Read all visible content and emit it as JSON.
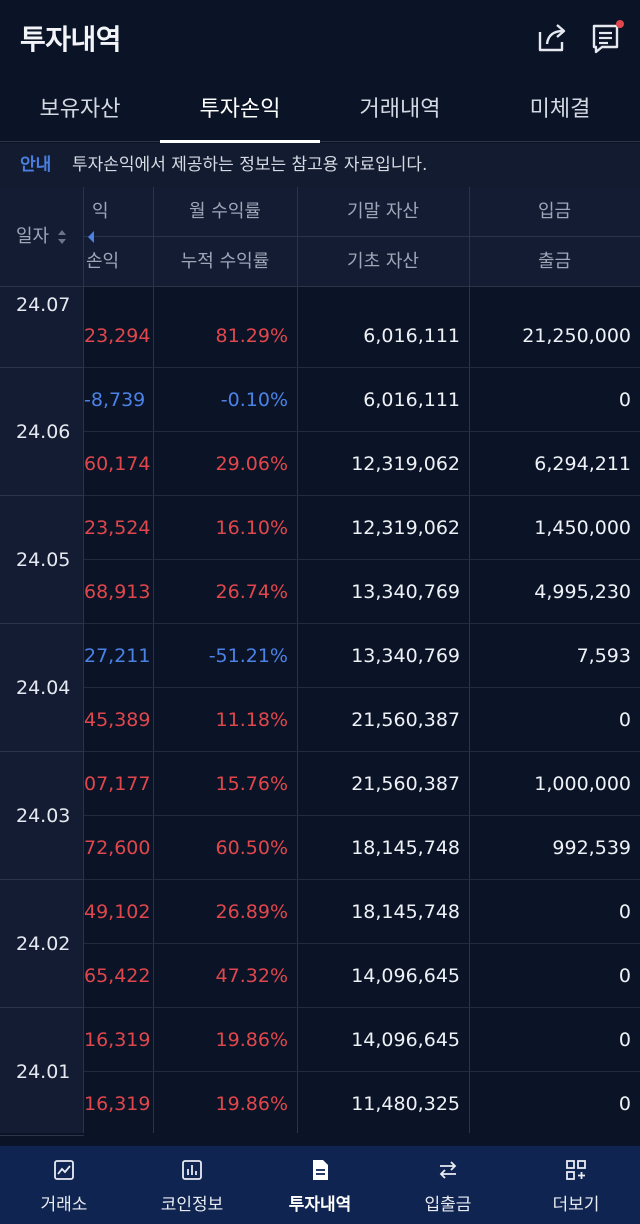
{
  "header": {
    "title": "투자내역",
    "share_icon": "share-icon",
    "chat_icon": "chat-icon",
    "notify_color": "#e0474c"
  },
  "tabs": [
    {
      "label": "보유자산",
      "active": false
    },
    {
      "label": "투자손익",
      "active": true
    },
    {
      "label": "거래내역",
      "active": false
    },
    {
      "label": "미체결",
      "active": false
    }
  ],
  "notice": {
    "tag": "안내",
    "message": "투자손익에서 제공하는 정보는 참고용 자료입니다."
  },
  "table": {
    "date_header": "일자",
    "headers_top": [
      "익",
      "월 수익률",
      "기말 자산",
      "입금"
    ],
    "headers_bottom": [
      "손익",
      "누적 수익률",
      "기초 자산",
      "출금"
    ],
    "groups": [
      {
        "date": "24.07",
        "rows": [
          {
            "pnl": "23,294",
            "rate": "81.29%",
            "asset": "6,016,111",
            "flow": "21,250,000",
            "sign": "pos"
          }
        ]
      },
      {
        "date": "24.06",
        "rows": [
          {
            "pnl": "-8,739",
            "rate": "-0.10%",
            "asset": "6,016,111",
            "flow": "0",
            "sign": "neg"
          },
          {
            "pnl": "60,174",
            "rate": "29.06%",
            "asset": "12,319,062",
            "flow": "6,294,211",
            "sign": "pos"
          }
        ]
      },
      {
        "date": "24.05",
        "rows": [
          {
            "pnl": "23,524",
            "rate": "16.10%",
            "asset": "12,319,062",
            "flow": "1,450,000",
            "sign": "pos"
          },
          {
            "pnl": "68,913",
            "rate": "26.74%",
            "asset": "13,340,769",
            "flow": "4,995,230",
            "sign": "pos"
          }
        ]
      },
      {
        "date": "24.04",
        "rows": [
          {
            "pnl": "27,211",
            "rate": "-51.21%",
            "asset": "13,340,769",
            "flow": "7,593",
            "sign": "neg"
          },
          {
            "pnl": "45,389",
            "rate": "11.18%",
            "asset": "21,560,387",
            "flow": "0",
            "sign": "pos"
          }
        ]
      },
      {
        "date": "24.03",
        "rows": [
          {
            "pnl": "07,177",
            "rate": "15.76%",
            "asset": "21,560,387",
            "flow": "1,000,000",
            "sign": "pos"
          },
          {
            "pnl": "72,600",
            "rate": "60.50%",
            "asset": "18,145,748",
            "flow": "992,539",
            "sign": "pos"
          }
        ]
      },
      {
        "date": "24.02",
        "rows": [
          {
            "pnl": "49,102",
            "rate": "26.89%",
            "asset": "18,145,748",
            "flow": "0",
            "sign": "pos"
          },
          {
            "pnl": "65,422",
            "rate": "47.32%",
            "asset": "14,096,645",
            "flow": "0",
            "sign": "pos"
          }
        ]
      },
      {
        "date": "24.01",
        "rows": [
          {
            "pnl": "16,319",
            "rate": "19.86%",
            "asset": "14,096,645",
            "flow": "0",
            "sign": "pos"
          },
          {
            "pnl": "16,319",
            "rate": "19.86%",
            "asset": "11,480,325",
            "flow": "0",
            "sign": "pos"
          }
        ]
      }
    ]
  },
  "colors": {
    "positive": "#e0474c",
    "negative": "#4b82e6"
  },
  "bottom_nav": [
    {
      "label": "거래소",
      "icon": "chart-icon",
      "active": false
    },
    {
      "label": "코인정보",
      "icon": "bar-chart-icon",
      "active": false
    },
    {
      "label": "투자내역",
      "icon": "document-icon",
      "active": true
    },
    {
      "label": "입출금",
      "icon": "transfer-icon",
      "active": false
    },
    {
      "label": "더보기",
      "icon": "more-grid-icon",
      "active": false
    }
  ]
}
